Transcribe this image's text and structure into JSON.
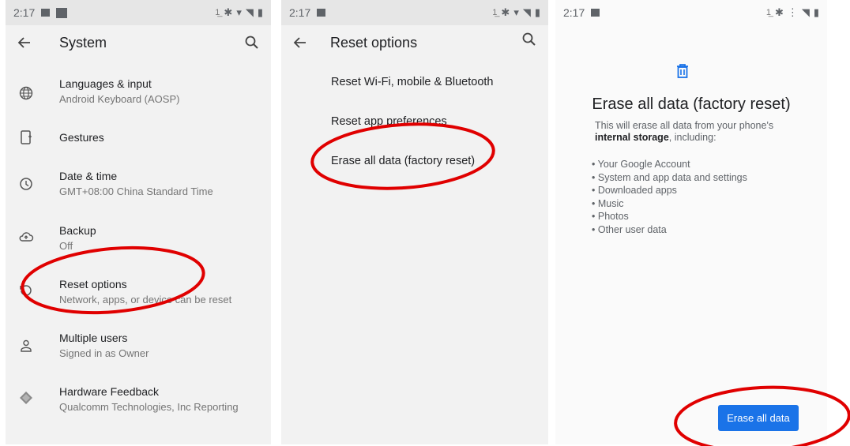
{
  "system_screen": {
    "status_time": "2:17",
    "title": "System",
    "items": [
      {
        "title": "Languages & input",
        "subtitle": "Android Keyboard (AOSP)",
        "icon": "globe-icon"
      },
      {
        "title": "Gestures",
        "subtitle": "",
        "icon": "gestures-phone-icon"
      },
      {
        "title": "Date & time",
        "subtitle": "GMT+08:00 China Standard Time",
        "icon": "clock-icon"
      },
      {
        "title": "Backup",
        "subtitle": "Off",
        "icon": "cloud-upload-icon"
      },
      {
        "title": "Reset options",
        "subtitle": "Network, apps, or device can be reset",
        "icon": "reset-history-icon"
      },
      {
        "title": "Multiple users",
        "subtitle": "Signed in as Owner",
        "icon": "person-icon"
      },
      {
        "title": "Hardware Feedback",
        "subtitle": "Qualcomm Technologies, Inc Reporting",
        "icon": "diamond-app-icon"
      }
    ]
  },
  "reset_screen": {
    "status_time": "2:17",
    "title": "Reset options",
    "items": [
      "Reset Wi-Fi, mobile & Bluetooth",
      "Reset app preferences",
      "Erase all data (factory reset)"
    ]
  },
  "erase_screen": {
    "status_time": "2:17",
    "title": "Erase all data (factory reset)",
    "desc_before": "This will erase all data from your phone's",
    "desc_bold": "internal storage",
    "desc_after": ", including:",
    "bullets": [
      "Your Google Account",
      "System and app data and settings",
      "Downloaded apps",
      "Music",
      "Photos",
      "Other user data"
    ],
    "button_label": "Erase all data"
  },
  "colors": {
    "accent": "#1a73e8",
    "annotation": "#e00000",
    "panel_bg": "#f2f2f2"
  }
}
